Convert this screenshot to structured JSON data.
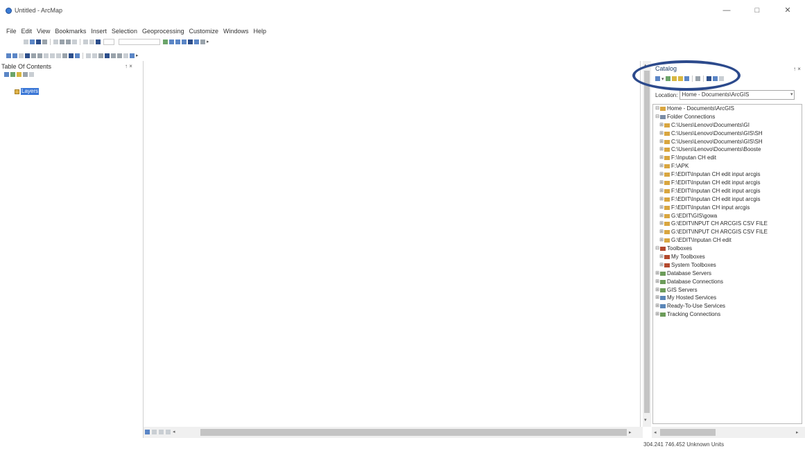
{
  "window": {
    "title": "Untitled - ArcMap",
    "minimize": "—",
    "restore": "□",
    "close": "✕"
  },
  "menus": [
    "File",
    "Edit",
    "View",
    "Bookmarks",
    "Insert",
    "Selection",
    "Geoprocessing",
    "Customize",
    "Windows",
    "Help"
  ],
  "toc": {
    "title": "Table Of Contents",
    "pin": "↑ ×",
    "layers_label": "Layers"
  },
  "catalog": {
    "title": "Catalog",
    "pin": "↑ ×",
    "location_label": "Location:",
    "location_value": "Home - Documents\\ArcGIS",
    "tree": [
      {
        "exp": "⊟",
        "icon_color": "#d9a640",
        "label": "Home - Documents\\ArcGIS"
      },
      {
        "exp": "⊟",
        "icon_color": "#7a8da6",
        "label": "Folder Connections"
      },
      {
        "exp": "⊞",
        "icon_color": "#d9a640",
        "label": "C:\\Users\\Lenovo\\Documents\\GI"
      },
      {
        "exp": "⊞",
        "icon_color": "#d9a640",
        "label": "C:\\Users\\Lenovo\\Documents\\GIS\\SH"
      },
      {
        "exp": "⊞",
        "icon_color": "#d9a640",
        "label": "C:\\Users\\Lenovo\\Documents\\GIS\\SH"
      },
      {
        "exp": "⊞",
        "icon_color": "#d9a640",
        "label": "C:\\Users\\Lenovo\\Documents\\Booste"
      },
      {
        "exp": "⊞",
        "icon_color": "#d9a640",
        "label": "F:\\Inputan CH edit"
      },
      {
        "exp": "⊞",
        "icon_color": "#d9a640",
        "label": "F:\\APK"
      },
      {
        "exp": "⊞",
        "icon_color": "#d9a640",
        "label": "F:\\EDIT\\Inputan CH edit input arcgis"
      },
      {
        "exp": "⊞",
        "icon_color": "#d9a640",
        "label": "F:\\EDIT\\Inputan CH edit input arcgis"
      },
      {
        "exp": "⊞",
        "icon_color": "#d9a640",
        "label": "F:\\EDIT\\Inputan CH edit input arcgis"
      },
      {
        "exp": "⊞",
        "icon_color": "#d9a640",
        "label": "F:\\EDIT\\Inputan CH edit input arcgis"
      },
      {
        "exp": "⊞",
        "icon_color": "#d9a640",
        "label": "F:\\EDIT\\Inputan CH input arcgis"
      },
      {
        "exp": "⊞",
        "icon_color": "#d9a640",
        "label": "G:\\EDIT\\GIS\\gowa"
      },
      {
        "exp": "⊞",
        "icon_color": "#d9a640",
        "label": "G:\\EDIT\\INPUT CH ARCGIS CSV FILE"
      },
      {
        "exp": "⊞",
        "icon_color": "#d9a640",
        "label": "G:\\EDIT\\INPUT CH ARCGIS CSV FILE"
      },
      {
        "exp": "⊞",
        "icon_color": "#d9a640",
        "label": "G:\\EDIT\\Inputan CH edit"
      },
      {
        "exp": "⊟",
        "icon_color": "#b34a2e",
        "label": "Toolboxes"
      },
      {
        "exp": "⊞",
        "icon_color": "#b34a2e",
        "label": "My Toolboxes"
      },
      {
        "exp": "⊞",
        "icon_color": "#b34a2e",
        "label": "System Toolboxes"
      },
      {
        "exp": "⊞",
        "icon_color": "#6c9c5a",
        "label": "Database Servers"
      },
      {
        "exp": "⊞",
        "icon_color": "#6c9c5a",
        "label": "Database Connections"
      },
      {
        "exp": "⊞",
        "icon_color": "#6c9c5a",
        "label": "GIS Servers"
      },
      {
        "exp": "⊞",
        "icon_color": "#5a86b8",
        "label": "My Hosted Services"
      },
      {
        "exp": "⊞",
        "icon_color": "#5a86b8",
        "label": "Ready-To-Use Services"
      },
      {
        "exp": "⊞",
        "icon_color": "#6c9c5a",
        "label": "Tracking Connections"
      }
    ]
  },
  "status": {
    "coords": "304.241  746.452 Unknown Units"
  },
  "colors": {
    "highlight_ellipse": "#2c4a8c",
    "selection": "#3976d6"
  }
}
